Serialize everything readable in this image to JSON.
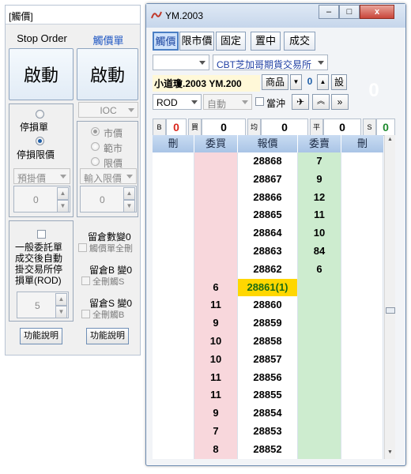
{
  "left_panel": {
    "title": "[觸價]",
    "stop_order": {
      "header": "Stop Order",
      "launch_button": "啟動",
      "stop_loss_label": "停損單",
      "stop_limit_label": "停損限價",
      "price_select": "預掛價",
      "qty_value": "0"
    },
    "touch_order": {
      "header": "觸價單",
      "launch_button": "啟動",
      "type_select": "IOC",
      "market_label": "市價",
      "range_label": "範市",
      "limit_label": "限價",
      "price_select": "輸入限價",
      "qty_value": "0"
    },
    "general": {
      "text_line1": "一般委託單",
      "text_line2": "成交後自動",
      "text_line3": "掛交易所停",
      "text_line4": "損單(ROD)",
      "qty_value": "5"
    },
    "pending": {
      "count_label": "留倉數變0",
      "cancel_touch_all": "觸價單全刪",
      "b_count_label": "留倉B 變0",
      "cancel_s_all": "全刪觸S",
      "s_count_label": "留倉S 變0",
      "cancel_b_all": "全刪觸B"
    },
    "help_button": "功能說明",
    "help_button2": "功能說明"
  },
  "window": {
    "title": "YM.2003",
    "min": "–",
    "max": "□",
    "close": "x"
  },
  "tabs": [
    "觸價",
    "限市價",
    "固定",
    "置中",
    "成交"
  ],
  "toolbar": {
    "account_select": "",
    "exchange_select": "CBT芝加哥期貨交易所",
    "product_label": "小道瓊.2003 YM.200",
    "product_btn": "商品",
    "qty": "0",
    "set_btn": "設",
    "rod_select": "ROD",
    "auto_select": "自動",
    "offset_label": "當沖",
    "big_zero": "0"
  },
  "stats": {
    "b_label": "B",
    "b_value": "0",
    "buy_label": "買",
    "buy_value": "0",
    "avg_label": "均",
    "avg_value": "0",
    "flat_label": "平",
    "flat_value": "0",
    "s_label": "S",
    "s_value": "0"
  },
  "grid": {
    "headers": [
      "刪",
      "委買",
      "報價",
      "委賣",
      "刪"
    ],
    "rows": [
      {
        "bid": "",
        "price": "28868",
        "ask": "7"
      },
      {
        "bid": "",
        "price": "28867",
        "ask": "9"
      },
      {
        "bid": "",
        "price": "28866",
        "ask": "12"
      },
      {
        "bid": "",
        "price": "28865",
        "ask": "11"
      },
      {
        "bid": "",
        "price": "28864",
        "ask": "10"
      },
      {
        "bid": "",
        "price": "28863",
        "ask": "84"
      },
      {
        "bid": "",
        "price": "28862",
        "ask": "6"
      },
      {
        "bid": "6",
        "price": "28861(1)",
        "ask": "",
        "last": true
      },
      {
        "bid": "11",
        "price": "28860",
        "ask": ""
      },
      {
        "bid": "9",
        "price": "28859",
        "ask": ""
      },
      {
        "bid": "10",
        "price": "28858",
        "ask": ""
      },
      {
        "bid": "10",
        "price": "28857",
        "ask": ""
      },
      {
        "bid": "11",
        "price": "28856",
        "ask": ""
      },
      {
        "bid": "11",
        "price": "28855",
        "ask": ""
      },
      {
        "bid": "9",
        "price": "28854",
        "ask": ""
      },
      {
        "bid": "7",
        "price": "28853",
        "ask": ""
      },
      {
        "bid": "8",
        "price": "28852",
        "ask": ""
      }
    ]
  },
  "colors": {
    "bid_bg": "#f8d7dc",
    "ask_bg": "#cdeccf",
    "last_price_bg": "#ffd700",
    "last_price_fg": "#1c6b12",
    "accent": "#1c46a0"
  }
}
